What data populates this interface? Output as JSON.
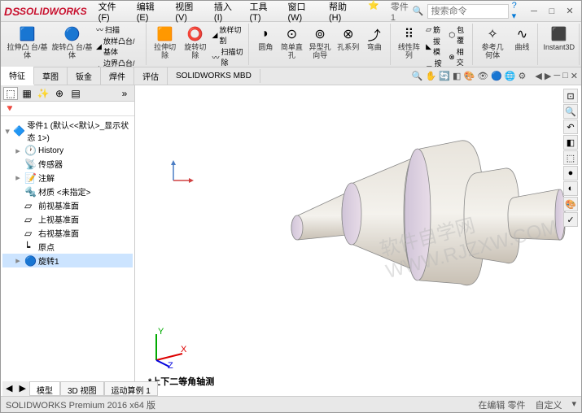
{
  "title": {
    "app": "SOLIDWORKS",
    "part": "零件1"
  },
  "menu": [
    "文件(F)",
    "编辑(E)",
    "视图(V)",
    "插入(I)",
    "工具(T)",
    "窗口(W)",
    "帮助(H)"
  ],
  "search": {
    "placeholder": "搜索命令"
  },
  "ribbon": {
    "g1": [
      {
        "label": "拉伸凸\n台/基体"
      },
      {
        "label": "旋转凸\n台/基体"
      }
    ],
    "g1b": [
      "扫描",
      "放样凸台/基体",
      "边界凸台/基体"
    ],
    "g2": [
      {
        "label": "拉伸切\n除"
      },
      {
        "label": "旋转切\n除"
      }
    ],
    "g2b": [
      "放样切割",
      "扫描切除",
      "放样切割"
    ],
    "g3": [
      "圆角",
      "简单直\n孔",
      "异型孔\n向导",
      "孔系列",
      "弯曲"
    ],
    "g4": [
      "线性阵\n列",
      "筋",
      "按接"
    ],
    "g4b": [
      "拔模",
      "相交",
      "包覆"
    ],
    "g5": [
      "参考几\n何体",
      "曲线"
    ],
    "instant": "Instant3D"
  },
  "tabs": [
    "特征",
    "草图",
    "钣金",
    "焊件",
    "评估",
    "SOLIDWORKS MBD"
  ],
  "sidebar_icons": [
    "funnel",
    "grid",
    "wand",
    "target",
    "list"
  ],
  "tree": {
    "root": "零件1 (默认<<默认>_显示状态 1>)",
    "items": [
      "History",
      "传感器",
      "注解",
      "材质 <未指定>",
      "前视基准面",
      "上视基准面",
      "右视基准面",
      "原点",
      "旋转1"
    ]
  },
  "bottom_tabs": [
    "模型",
    "3D 视图",
    "运动算例 1"
  ],
  "view_label": "*上下二等角轴测",
  "status": {
    "left": "SOLIDWORKS Premium 2016 x64 版",
    "right": [
      "在编辑 零件",
      "自定义"
    ]
  },
  "watermark": "软件自学网\nWWW.RJZXW.COM",
  "chart_data": null
}
